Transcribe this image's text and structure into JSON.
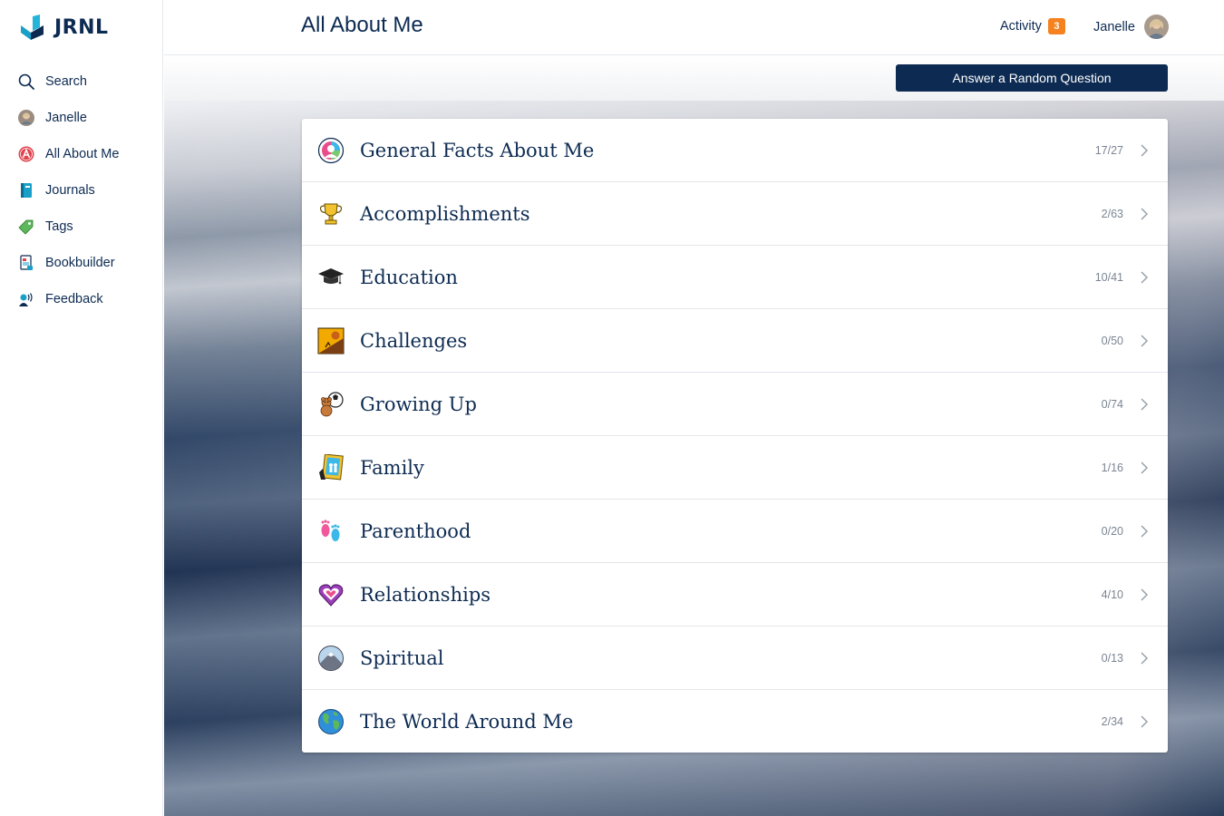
{
  "app": {
    "logo_text": "JRNL",
    "page_title": "All About Me"
  },
  "sidebar": {
    "items": [
      {
        "label": "Search",
        "icon": "search-icon"
      },
      {
        "label": "Janelle",
        "icon": "avatar-icon"
      },
      {
        "label": "All About Me",
        "icon": "all-about-me-icon"
      },
      {
        "label": "Journals",
        "icon": "journal-book-icon"
      },
      {
        "label": "Tags",
        "icon": "tag-icon"
      },
      {
        "label": "Bookbuilder",
        "icon": "bookbuilder-icon"
      },
      {
        "label": "Feedback",
        "icon": "feedback-icon"
      }
    ]
  },
  "header": {
    "activity_label": "Activity",
    "activity_count": "3",
    "user_name": "Janelle"
  },
  "toolbar": {
    "random_question_label": "Answer a Random Question"
  },
  "categories": [
    {
      "label": "General Facts About Me",
      "count": "17/27",
      "icon": "general-facts-icon"
    },
    {
      "label": "Accomplishments",
      "count": "2/63",
      "icon": "trophy-icon"
    },
    {
      "label": "Education",
      "count": "10/41",
      "icon": "graduation-cap-icon"
    },
    {
      "label": "Challenges",
      "count": "0/50",
      "icon": "challenges-icon"
    },
    {
      "label": "Growing Up",
      "count": "0/74",
      "icon": "teddy-bear-icon"
    },
    {
      "label": "Family",
      "count": "1/16",
      "icon": "family-photo-icon"
    },
    {
      "label": "Parenthood",
      "count": "0/20",
      "icon": "baby-feet-icon"
    },
    {
      "label": "Relationships",
      "count": "4/10",
      "icon": "heart-icon"
    },
    {
      "label": "Spiritual",
      "count": "0/13",
      "icon": "mountain-icon"
    },
    {
      "label": "The World Around Me",
      "count": "2/34",
      "icon": "globe-icon"
    }
  ],
  "colors": {
    "navy": "#0d2b52",
    "badge_orange": "#f5821f",
    "muted_text": "#7b8593"
  }
}
